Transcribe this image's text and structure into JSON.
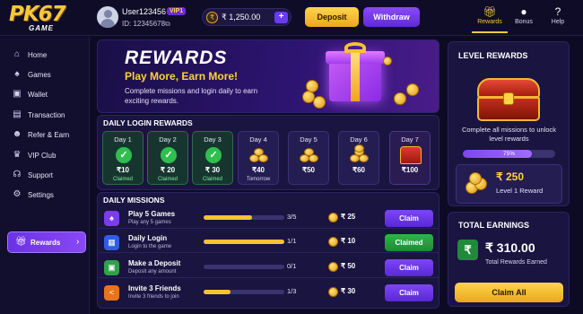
{
  "header": {
    "logo_main": "PK67",
    "logo_sub": "GAME",
    "username": "User123456",
    "vip_badge": "VIP1",
    "user_id": "ID: 12345678",
    "balance": "₹ 1,250.00",
    "deposit_label": "Deposit",
    "withdraw_label": "Withdraw",
    "nav": [
      {
        "label": "Rewards",
        "icon": "gift-icon",
        "active": true
      },
      {
        "label": "Bonus",
        "icon": "chat-bubble-icon",
        "active": false
      },
      {
        "label": "Help",
        "icon": "help-icon",
        "active": false
      }
    ]
  },
  "sidebar": {
    "items": [
      {
        "label": "Home",
        "icon": "home-icon"
      },
      {
        "label": "Games",
        "icon": "gamepad-icon"
      },
      {
        "label": "Wallet",
        "icon": "wallet-icon"
      },
      {
        "label": "Transaction",
        "icon": "receipt-icon"
      },
      {
        "label": "Refer & Earn",
        "icon": "users-icon"
      },
      {
        "label": "VIP Club",
        "icon": "crown-icon"
      },
      {
        "label": "Support",
        "icon": "headset-icon"
      },
      {
        "label": "Settings",
        "icon": "gear-icon"
      }
    ],
    "active_item": {
      "label": "Rewards",
      "icon": "gift-icon"
    }
  },
  "hero": {
    "title": "REWARDS",
    "subtitle": "Play More, Earn More!",
    "description": "Complete missions and login daily to earn exciting rewards."
  },
  "daily_login": {
    "title": "DAILY LOGIN REWARDS",
    "days": [
      {
        "label": "Day 1",
        "amount": "₹10",
        "status": "Claimed",
        "state": "claimed"
      },
      {
        "label": "Day 2",
        "amount": "₹ 20",
        "status": "Claimed",
        "state": "claimed"
      },
      {
        "label": "Day 3",
        "amount": "₹ 30",
        "status": "Claimed",
        "state": "claimed"
      },
      {
        "label": "Day 4",
        "amount": "₹40",
        "status": "Tomorrow",
        "state": "next"
      },
      {
        "label": "Day 5",
        "amount": "₹50",
        "status": "",
        "state": "locked"
      },
      {
        "label": "Day 6",
        "amount": "₹60",
        "status": "",
        "state": "locked"
      },
      {
        "label": "Day 7",
        "amount": "₹100",
        "status": "",
        "state": "chest"
      }
    ]
  },
  "daily_missions": {
    "title": "DAILY MISSIONS",
    "missions": [
      {
        "title": "Play 5 Games",
        "desc": "Play any 5 games",
        "progress": "3/5",
        "fraction": 0.6,
        "reward": "₹ 25",
        "button": "Claim",
        "done": false,
        "icon": "gamepad-icon",
        "color": "#7a3cf0"
      },
      {
        "title": "Daily Login",
        "desc": "Login to the game",
        "progress": "1/1",
        "fraction": 1.0,
        "reward": "₹ 10",
        "button": "Claimed",
        "done": true,
        "icon": "calendar-icon",
        "color": "#2f5de6"
      },
      {
        "title": "Make a Deposit",
        "desc": "Deposit any amount",
        "progress": "0/1",
        "fraction": 0.0,
        "reward": "₹ 50",
        "button": "Claim",
        "done": false,
        "icon": "wallet-icon",
        "color": "#2ea24a"
      },
      {
        "title": "Invite 3 Friends",
        "desc": "Invite 3 friends to join",
        "progress": "1/3",
        "fraction": 0.33,
        "reward": "₹ 30",
        "button": "Claim",
        "done": false,
        "icon": "share-icon",
        "color": "#e8731c"
      }
    ]
  },
  "level_rewards": {
    "title": "LEVEL REWARDS",
    "description": "Complete all missions to unlock level rewards",
    "progress_text": "75%",
    "progress": 0.75,
    "reward_amount": "₹ 250",
    "reward_label": "Level 1 Reward"
  },
  "total_earnings": {
    "title": "TOTAL EARNINGS",
    "amount": "₹ 310.00",
    "label": "Total Rewards Earned",
    "claim_all": "Claim All"
  }
}
